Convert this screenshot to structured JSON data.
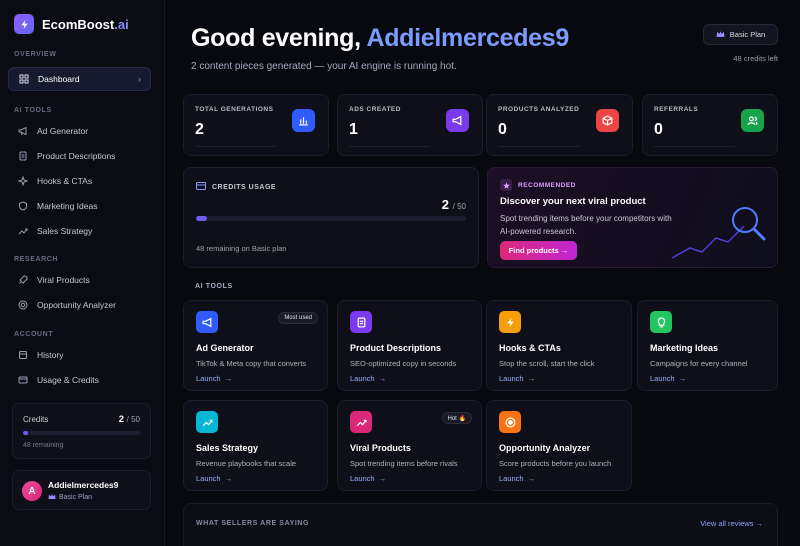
{
  "brand": {
    "name": "EcomBoost",
    "suffix": ".ai"
  },
  "sidebar": {
    "overview_label": "OVERVIEW",
    "dashboard": "Dashboard",
    "ai_tools_label": "AI TOOLS",
    "ai_tools": [
      "Ad Generator",
      "Product Descriptions",
      "Hooks & CTAs",
      "Marketing Ideas",
      "Sales Strategy"
    ],
    "research_label": "RESEARCH",
    "research": [
      "Viral Products",
      "Opportunity Analyzer"
    ],
    "account_label": "ACCOUNT",
    "account": [
      "History",
      "Usage & Credits"
    ],
    "credits": {
      "label": "Credits",
      "used": "2",
      "total": "/ 50",
      "remaining": "48 remaining",
      "fraction": 0.04
    },
    "user": {
      "initial": "A",
      "name": "Addielmercedes9",
      "plan": "Basic Plan"
    }
  },
  "header": {
    "greeting": "Good evening, ",
    "name": "Addielmercedes9",
    "subtitle": "2 content pieces generated — your AI engine is running hot.",
    "plan_button": "Basic Plan",
    "credits_left": "48 credits left"
  },
  "stats": [
    {
      "label": "TOTAL GENERATIONS",
      "value": "2",
      "color": "#2f5bff",
      "icon": "bar-chart-icon"
    },
    {
      "label": "ADS CREATED",
      "value": "1",
      "color": "#7c3aed",
      "icon": "megaphone-icon"
    },
    {
      "label": "PRODUCTS ANALYZED",
      "value": "0",
      "color": "#ef4444",
      "icon": "box-icon"
    },
    {
      "label": "REFERRALS",
      "value": "0",
      "color": "#16a34a",
      "icon": "users-icon"
    }
  ],
  "credits_usage": {
    "title": "CREDITS USAGE",
    "used": "2",
    "total": "/ 50",
    "remaining": "48 remaining on Basic plan",
    "fraction": 0.04
  },
  "recommended": {
    "tag": "RECOMMENDED",
    "title": "Discover your next viral product",
    "text": "Spot trending items before your competitors with AI-powered research.",
    "button": "Find products →"
  },
  "ai_tools": {
    "label": "AI TOOLS",
    "items": [
      {
        "name": "Ad Generator",
        "desc": "TikTok & Meta copy that converts",
        "launch": "Launch",
        "arrow": "→",
        "badge": "Most used",
        "color": "#2f5bff"
      },
      {
        "name": "Product Descriptions",
        "desc": "SEO-optimized copy in seconds",
        "launch": "Launch",
        "arrow": "→",
        "badge": "",
        "color": "#7c3aed"
      },
      {
        "name": "Hooks & CTAs",
        "desc": "Stop the scroll, start the click",
        "launch": "Launch",
        "arrow": "→",
        "badge": "",
        "color": "#f59e0b"
      },
      {
        "name": "Marketing Ideas",
        "desc": "Campaigns for every channel",
        "launch": "Launch",
        "arrow": "→",
        "badge": "",
        "color": "#22c55e"
      },
      {
        "name": "Sales Strategy",
        "desc": "Revenue playbooks that scale",
        "launch": "Launch",
        "arrow": "→",
        "badge": "",
        "color": "#06b6d4"
      },
      {
        "name": "Viral Products",
        "desc": "Spot trending items before rivals",
        "launch": "Launch",
        "arrow": "→",
        "badge": "Hot 🔥",
        "color": "#db2777"
      },
      {
        "name": "Opportunity Analyzer",
        "desc": "Score products before you launch",
        "launch": "Launch",
        "arrow": "→",
        "badge": "",
        "color": "#f97316"
      }
    ]
  },
  "testimonials": {
    "label": "WHAT SELLERS ARE SAYING",
    "link": "View all reviews →"
  }
}
